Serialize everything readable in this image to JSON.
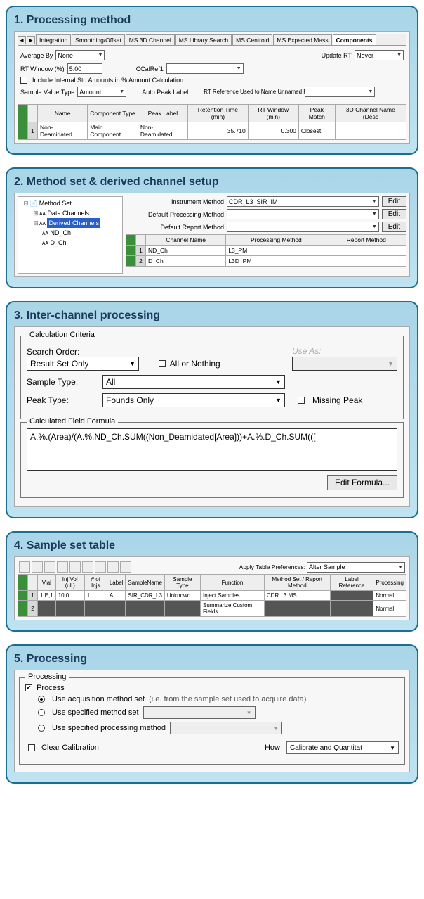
{
  "panels": {
    "p1": {
      "title": "1. Processing method",
      "tabs": [
        "Integration",
        "Smoothing/Offset",
        "MS 3D Channel",
        "MS Library Search",
        "MS Centroid",
        "MS Expected Mass",
        "Components"
      ],
      "activeTab": "Components",
      "fields": {
        "averageByLabel": "Average By",
        "averageByValue": "None",
        "updateRTLabel": "Update RT",
        "updateRTValue": "Never",
        "rtWindowLabel": "RT Window (%)",
        "rtWindowValue": "5.00",
        "ccalRefLabel": "CCalRef1",
        "ccalRefValue": "",
        "includeStdLabel": "Include Internal Std Amounts in % Amount Calculation",
        "sampleValueTypeLabel": "Sample Value Type",
        "sampleValueTypeValue": "Amount",
        "autoPeakLabel": "Auto Peak Label",
        "rtRefLabel": "RT Reference Used to Name Unnamed Peaks by RRT:",
        "rtRefValue": ""
      },
      "tableHeaders": [
        "",
        "Name",
        "Component Type",
        "Peak Label",
        "Retention Time (min)",
        "RT Window (min)",
        "Peak Match",
        "3D Channel Name (Desc"
      ],
      "tableRow": {
        "num": "1",
        "name": "Non-Deamidated",
        "ctype": "Main Component",
        "plabel": "Non-Deamidated",
        "rt": "35.710",
        "rtw": "0.300",
        "match": "Closest",
        "ch3d": ""
      }
    },
    "p2": {
      "title": "2. Method set & derived channel setup",
      "tree": {
        "root": "Method Set",
        "dataCh": "Data Channels",
        "derCh": "Derived Channels",
        "nd": "ND_Ch",
        "d": "D_Ch"
      },
      "form": {
        "instLabel": "Instrument Method",
        "instValue": "CDR_L3_SIR_IM",
        "defProcLabel": "Default Processing Method",
        "defProcValue": "",
        "defRepLabel": "Default Report Method",
        "defRepValue": "",
        "edit": "Edit"
      },
      "tableHeaders": [
        "",
        "Channel Name",
        "Processing Method",
        "Report Method"
      ],
      "rows": [
        {
          "num": "1",
          "ch": "ND_Ch",
          "pm": "L3_PM",
          "rm": ""
        },
        {
          "num": "2",
          "ch": "D_Ch",
          "pm": "L3D_PM",
          "rm": ""
        }
      ]
    },
    "p3": {
      "title": "3. Inter-channel processing",
      "calcCriteria": "Calculation Criteria",
      "searchOrderLabel": "Search Order:",
      "searchOrderValue": "Result Set Only",
      "allOrNothing": "All or Nothing",
      "useAsLabel": "Use As:",
      "useAsValue": "",
      "sampleTypeLabel": "Sample Type:",
      "sampleTypeValue": "All",
      "peakTypeLabel": "Peak Type:",
      "peakTypeValue": "Founds Only",
      "missingPeak": "Missing Peak",
      "formulaGroup": "Calculated Field Formula",
      "formula": "A.%.(Area)/(A.%.ND_Ch.SUM((Non_Deamidated[Area]))+A.%.D_Ch.SUM(([",
      "editFormula": "Edit Formula..."
    },
    "p4": {
      "title": "4. Sample set table",
      "applyLabel": "Apply Table Preferences:",
      "applyValue": "Alter Sample",
      "headers": [
        "",
        "Vial",
        "Inj Vol (uL)",
        "# of Injs",
        "Label",
        "SampleName",
        "Sample Type",
        "Function",
        "Method Set / Report Method",
        "Label Reference",
        "Processing"
      ],
      "rows": [
        {
          "num": "1",
          "vial": "1:E,1",
          "vol": "10.0",
          "injs": "1",
          "label": "A",
          "name": "SIR_CDR_L3",
          "stype": "Unknown",
          "func": "Inject Samples",
          "ms": "CDR L3 MS",
          "lref": "",
          "proc": "Normal"
        },
        {
          "num": "2",
          "vial": "",
          "vol": "",
          "injs": "",
          "label": "",
          "name": "",
          "stype": "",
          "func": "Summarize Custom Fields",
          "ms": "",
          "lref": "",
          "proc": "Normal"
        }
      ]
    },
    "p5": {
      "title": "5. Processing",
      "group": "Processing",
      "process": "Process",
      "opt1": "Use acquisition method set",
      "opt1hint": "(i.e. from the sample set used to acquire data)",
      "opt2": "Use specified method set",
      "opt3": "Use specified processing method",
      "clearCal": "Clear Calibration",
      "howLabel": "How:",
      "howValue": "Calibrate and Quantitat"
    }
  }
}
